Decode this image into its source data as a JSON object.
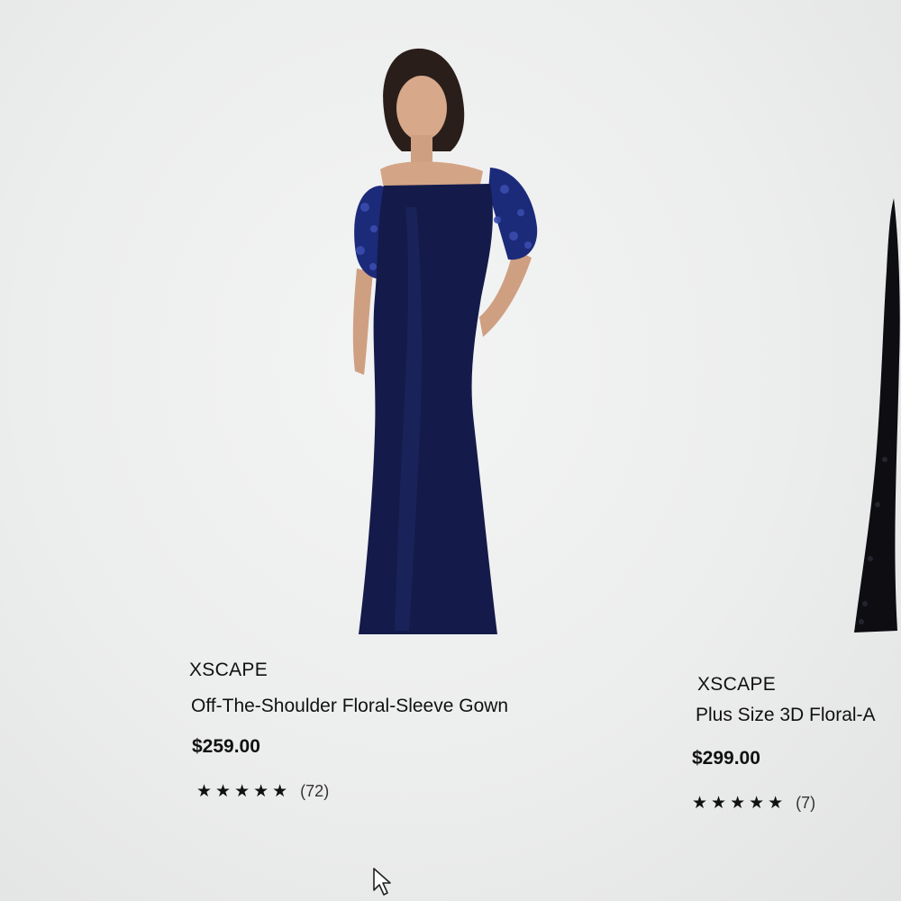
{
  "products": [
    {
      "brand": "XSCAPE",
      "name": "Off-The-Shoulder Floral-Sleeve Gown",
      "price": "$259.00",
      "rating": {
        "stars": 5,
        "stars_display": "★★★★★",
        "count": "(72)"
      },
      "dress_color": "#141b4a"
    },
    {
      "brand": "XSCAPE",
      "name": "Plus Size 3D Floral-A",
      "price": "$299.00",
      "rating": {
        "stars": 5,
        "stars_display": "★★★★★",
        "count": "(7)"
      },
      "dress_color": "#0d0d12"
    }
  ],
  "cursor": {
    "icon": "mouse-pointer-icon"
  }
}
